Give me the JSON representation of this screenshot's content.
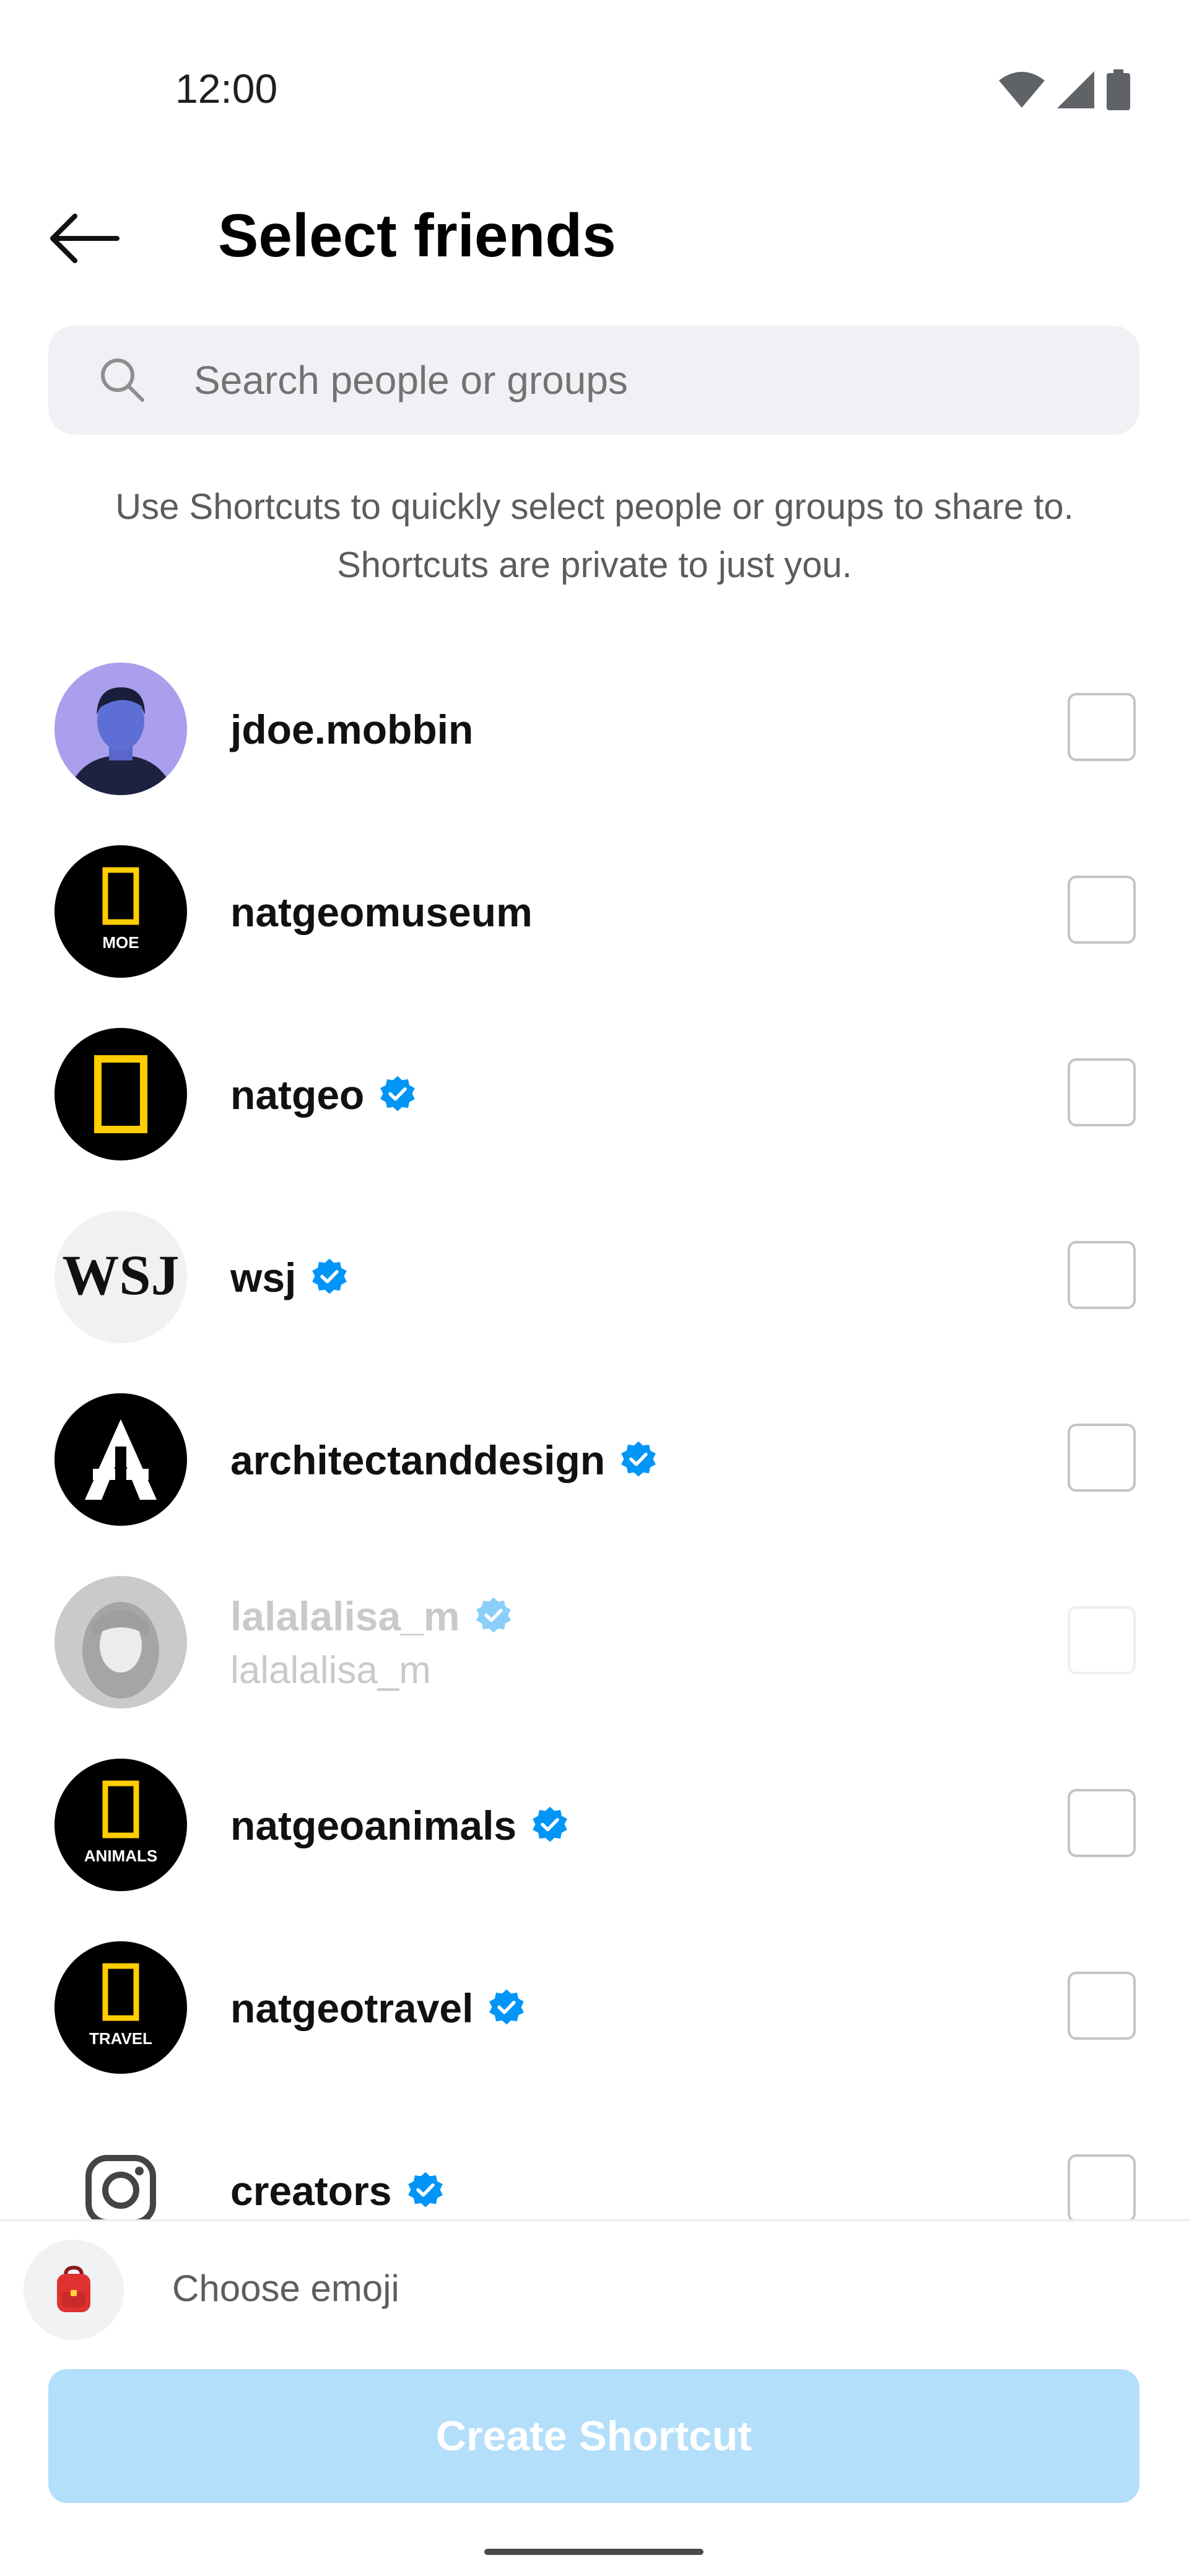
{
  "status_bar": {
    "time": "12:00"
  },
  "header": {
    "title": "Select friends"
  },
  "search": {
    "placeholder": "Search people or groups"
  },
  "hint": {
    "line1": "Use Shortcuts to quickly select people or groups to share to.",
    "line2": "Shortcuts are private to just you."
  },
  "friends": [
    {
      "username": "jdoe.mobbin",
      "verified": false,
      "selected": false,
      "avatar": "person-photo-purple"
    },
    {
      "username": "natgeomuseum",
      "verified": false,
      "selected": false,
      "avatar": "natgeo-logo",
      "avatar_caption": "MOE"
    },
    {
      "username": "natgeo",
      "verified": true,
      "selected": false,
      "avatar": "natgeo-logo"
    },
    {
      "username": "wsj",
      "verified": true,
      "selected": false,
      "avatar": "wsj-logo",
      "avatar_text": "WSJ"
    },
    {
      "username": "architectanddesign",
      "verified": true,
      "selected": false,
      "avatar": "architect-logo"
    },
    {
      "username": "lalalalisa_m",
      "subname": "lalalalisa_m",
      "verified": true,
      "selected": false,
      "disabled": true,
      "avatar": "person-photo-grayscale"
    },
    {
      "username": "natgeoanimals",
      "verified": true,
      "selected": false,
      "avatar": "natgeo-logo",
      "avatar_caption": "ANIMALS"
    },
    {
      "username": "natgeotravel",
      "verified": true,
      "selected": false,
      "avatar": "natgeo-logo",
      "avatar_caption": "TRAVEL"
    },
    {
      "username": "creators",
      "verified": true,
      "selected": false,
      "avatar": "instagram-logo"
    }
  ],
  "emoji": {
    "label": "Choose emoji",
    "icon": "backpack-icon"
  },
  "actions": {
    "create_label": "Create Shortcut"
  },
  "colors": {
    "accent": "#0095f6",
    "button_disabled": "#b3dffa",
    "search_bg": "#eff1f4",
    "natgeo_yellow": "#ffcd00"
  }
}
